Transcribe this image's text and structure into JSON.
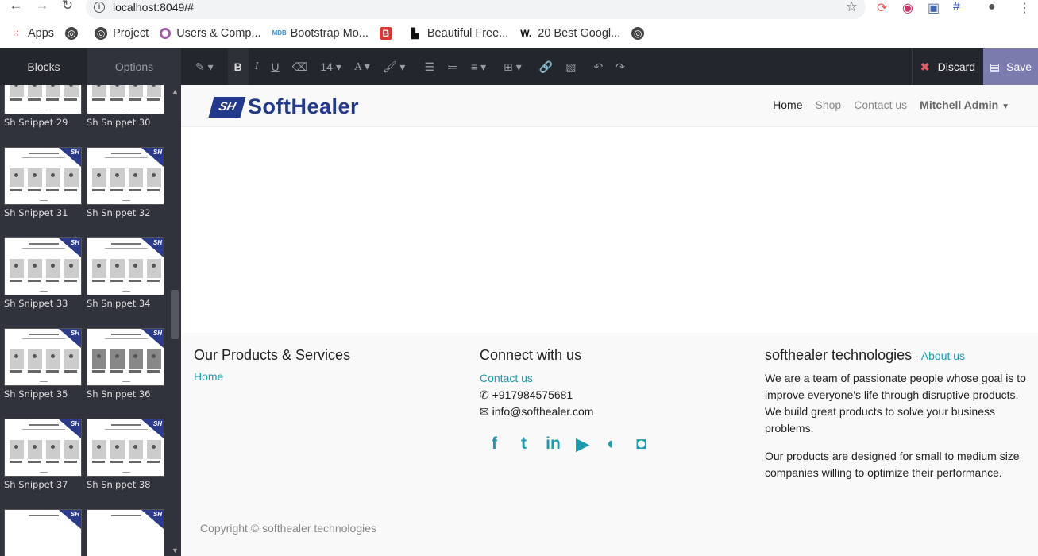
{
  "browser": {
    "url": "localhost:8049/#",
    "bookmarks": [
      {
        "label": "Apps",
        "icon": "apps-grid-icon"
      },
      {
        "label": "",
        "icon": "globe-icon"
      },
      {
        "label": "Project",
        "icon": "globe-icon"
      },
      {
        "label": "Users & Comp...",
        "icon": "odoo-icon"
      },
      {
        "label": "Bootstrap Mo...",
        "icon": "mdb-icon"
      },
      {
        "label": "Beautiful Free...",
        "icon": "b-icon"
      },
      {
        "label": "",
        "icon": "unsplash-icon"
      },
      {
        "label": "20 Best Googl...",
        "icon": "w-icon"
      },
      {
        "label": "",
        "icon": "globe-icon"
      }
    ]
  },
  "panel": {
    "tab_blocks": "Blocks",
    "tab_options": "Options",
    "snippets": [
      "Sh Snippet 29",
      "Sh Snippet 30",
      "Sh Snippet 31",
      "Sh Snippet 32",
      "Sh Snippet 33",
      "Sh Snippet 34",
      "Sh Snippet 35",
      "Sh Snippet 36",
      "Sh Snippet 37",
      "Sh Snippet 38"
    ]
  },
  "toolbar": {
    "font_size": "14",
    "discard": "Discard",
    "save": "Save"
  },
  "site": {
    "brand": "SoftHealer",
    "brand_mark": "SH",
    "menu": {
      "home": "Home",
      "shop": "Shop",
      "contact": "Contact us",
      "user": "Mitchell Admin"
    },
    "footer": {
      "products_title": "Our Products & Services",
      "products_link": "Home",
      "connect_title": "Connect with us",
      "connect_link": "Contact us",
      "phone": "+917984575681",
      "email": "info@softhealer.com",
      "company_title": "softhealer technologies",
      "company_sep": " - ",
      "about_link": "About us",
      "about_p1": "We are a team of passionate people whose goal is to improve everyone's life through disruptive products. We build great products to solve your business problems.",
      "about_p2": "Our products are designed for small to medium size companies willing to optimize their performance.",
      "copyright": "Copyright © softhealer technologies"
    }
  }
}
